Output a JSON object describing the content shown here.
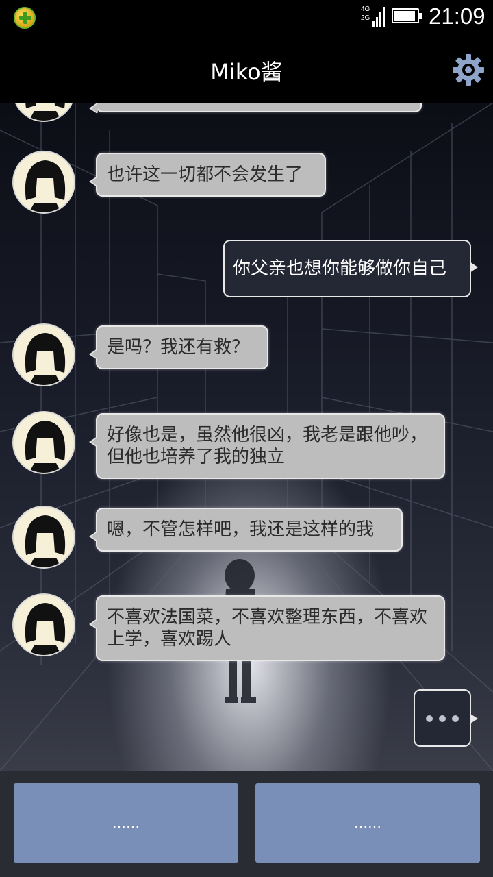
{
  "status_bar": {
    "network_top": "4G",
    "network_bottom": "2G",
    "time": "21:09",
    "battery_level": 0.95,
    "signal_bars": 4
  },
  "header": {
    "title": "Miko酱",
    "settings_icon": "gear-icon"
  },
  "messages": [
    {
      "from": "miko",
      "text": ""
    },
    {
      "from": "miko",
      "text": "也许这一切都不会发生了"
    },
    {
      "from": "me",
      "text": "你父亲也想你能够做你自己"
    },
    {
      "from": "miko",
      "text": "是吗？我还有救？"
    },
    {
      "from": "miko",
      "text": "好像也是，虽然他很凶，我老是跟他吵，但他也培养了我的独立"
    },
    {
      "from": "miko",
      "text": "嗯，不管怎样吧，我还是这样的我"
    },
    {
      "from": "miko",
      "text": "不喜欢法国菜，不喜欢整理东西，不喜欢上学，喜欢踢人"
    }
  ],
  "typing_indicator": "typing-dots-icon",
  "choices": [
    {
      "label": "……"
    },
    {
      "label": "……"
    }
  ],
  "colors": {
    "incoming_bubble": "#bdbdbd",
    "outgoing_bubble": "#242734",
    "choice_button": "#7a8fb8",
    "accent_gear": "#8ea4c8"
  }
}
